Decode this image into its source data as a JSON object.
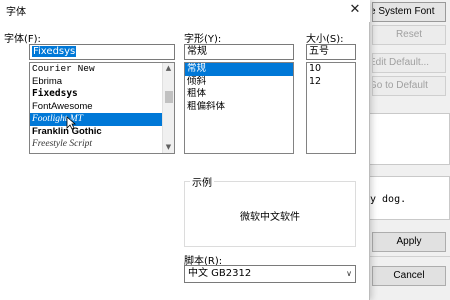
{
  "background_window": {
    "buttons": {
      "use_system_font": "se System Font",
      "reset": "Reset",
      "edit_default": "Edit Default...",
      "go_to_default": "Go to Default",
      "apply": "Apply",
      "cancel": "Cancel"
    },
    "preview_text": "y dog."
  },
  "dialog": {
    "title": "字体",
    "font_family": {
      "label": "字体(F):",
      "value": "Fixedsys",
      "items": [
        "Courier New",
        "Ebrima",
        "Fixedsys",
        "FontAwesome",
        "Footlight MT",
        "Franklin Gothic",
        "Freestyle Script"
      ],
      "selected_index": 4
    },
    "font_style": {
      "label": "字形(Y):",
      "value": "常规",
      "items": [
        "常规",
        "倾斜",
        "粗体",
        "粗偏斜体"
      ],
      "selected_index": 0
    },
    "size": {
      "label": "大小(S):",
      "value": "五号",
      "items": [
        "10",
        "12"
      ]
    },
    "sample": {
      "label": "示例",
      "text": "微软中文软件"
    },
    "script": {
      "label": "脚本(R):",
      "value": "中文 GB2312"
    }
  },
  "colors": {
    "selection": "#0078d7",
    "disabled_text": "#a0a0a0"
  },
  "icons": {
    "close": "close-icon",
    "help": "help-icon",
    "combo_arrow": "chevron-down-icon"
  }
}
